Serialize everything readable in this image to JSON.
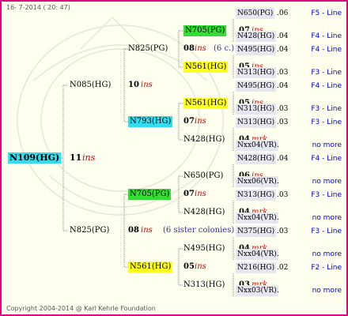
{
  "header": {
    "date": "16- 7-2014 ( 20: 47)",
    "copyright": "Copyright 2004-2014 @ Karl Kehrle Foundation"
  },
  "colors": {
    "border": "#e0007a",
    "background": "#fffff0",
    "cyan_box": "#33ddee",
    "green_box": "#33dd33",
    "yellow_box": "#ffff22",
    "link": "#0000cc",
    "ins_text": "#cc0000"
  },
  "root": {
    "label": "N109(HG)",
    "year": "11",
    "tag": "ins"
  },
  "gen1": [
    {
      "label": "N085(HG)",
      "year": "10",
      "tag": "ins"
    },
    {
      "label": "N825(PG)",
      "year": "08",
      "tag": "ins",
      "note": "(6 sister colonies)"
    }
  ],
  "gen2": [
    {
      "label": "N825(PG)",
      "year": "08",
      "tag": "ins",
      "note": "(6 c.)"
    },
    {
      "label": "N793(HG)",
      "year": "07",
      "tag": "ins"
    },
    {
      "label": "N705(PG)",
      "year": "07",
      "tag": "ins"
    },
    {
      "label": "N561(HG)",
      "year": "05",
      "tag": "ins"
    }
  ],
  "gen3": [
    {
      "label": "N705(PG)"
    },
    {
      "label": "N561(HG)",
      "year": "05",
      "tag": "ins"
    },
    {
      "label": "N561(HG)",
      "year": "05",
      "tag": "ins"
    },
    {
      "label": "N428(HG)",
      "year": "04",
      "tag": "mrk"
    },
    {
      "label": "N650(PG)",
      "year": "06",
      "tag": "ins"
    },
    {
      "label": "N428(HG)",
      "year": "04",
      "tag": "mrk"
    },
    {
      "label": "N495(HG)",
      "year": "04",
      "tag": "mrk"
    },
    {
      "label": "N313(HG)",
      "year": "03",
      "tag": "mrk"
    }
  ],
  "gen4": [
    {
      "label": "N650(PG)",
      "num": ".06",
      "link": "F5 - Line"
    },
    {
      "label": "N428(HG)",
      "num": ".04",
      "link": "F4 - Line"
    },
    {
      "label": "N495(HG)",
      "num": ".04",
      "link": "F4 - Line"
    },
    {
      "label": "N313(HG)",
      "num": ".03",
      "link": "F3 - Line"
    },
    {
      "label": "N495(HG)",
      "num": ".04",
      "link": "F4 - Line"
    },
    {
      "label": "N313(HG)",
      "num": ".03",
      "link": "F3 - Line"
    },
    {
      "label": "N313(HG)",
      "num": ".03",
      "link": "F3 - Line"
    },
    {
      "label": "Nxx04(VR)",
      "num": ".",
      "link": "no more"
    },
    {
      "label": "N428(HG)",
      "num": ".04",
      "link": "F4 - Line"
    },
    {
      "label": "Nxx06(VR)",
      "num": ".",
      "link": "no more"
    },
    {
      "label": "N313(HG)",
      "num": ".03",
      "link": "F3 - Line"
    },
    {
      "label": "Nxx04(VR)",
      "num": ".",
      "link": "no more"
    },
    {
      "label": "N375(HG)",
      "num": ".03",
      "link": "F3 - Line"
    },
    {
      "label": "Nxx04(VR)",
      "num": ".",
      "link": "no more"
    },
    {
      "label": "N216(HG)",
      "num": ".02",
      "link": "F2 - Line"
    },
    {
      "label": "Nxx03(VR)",
      "num": ".",
      "link": "no more"
    }
  ],
  "gen3_years_first": {
    "year": "07",
    "tag": "ins"
  }
}
